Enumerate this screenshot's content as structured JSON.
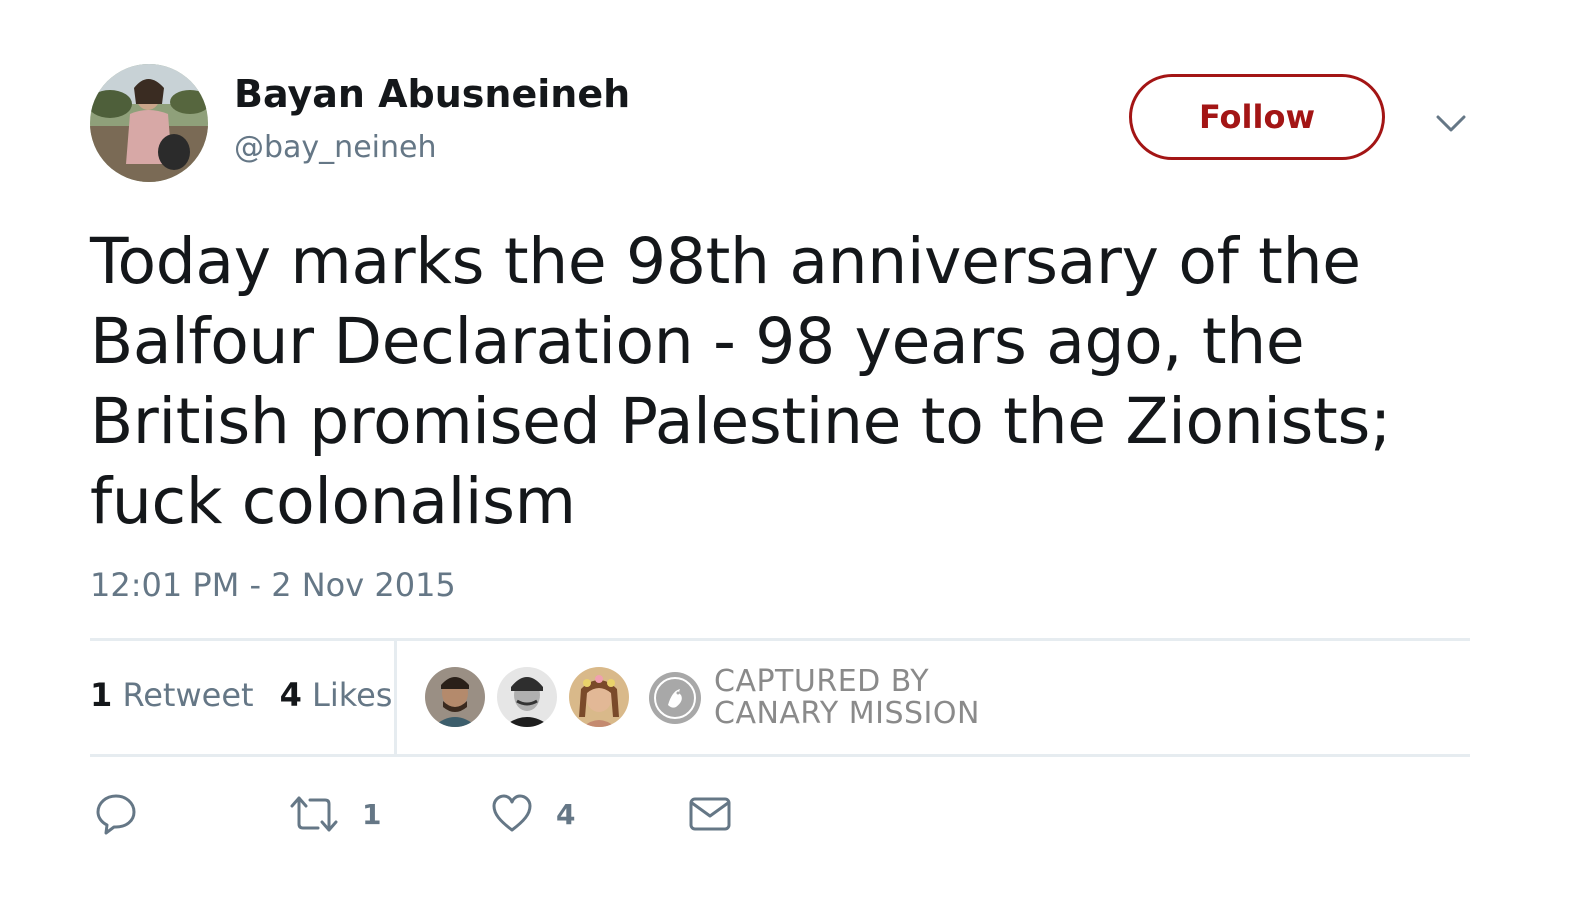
{
  "author": {
    "display_name": "Bayan Abusneineh",
    "handle": "@bay_neineh",
    "avatar_icon": "profile-photo"
  },
  "header": {
    "follow_label": "Follow",
    "caret_icon": "chevron-down-icon"
  },
  "tweet": {
    "text": "Today marks the 98th anniversary of the Balfour Declaration - 98 years ago, the British promised Palestine to the Zionists; fuck colonalism",
    "timestamp": "12:01 PM - 2 Nov 2015"
  },
  "stats": {
    "retweet_count": "1",
    "retweet_label": "Retweet",
    "like_count": "4",
    "like_label": "Likes"
  },
  "watermark": {
    "line1": "CAPTURED BY",
    "line2": "CANARY MISSION"
  },
  "actions": {
    "reply_icon": "reply-icon",
    "retweet_icon": "retweet-icon",
    "retweet_count": "1",
    "like_icon": "heart-icon",
    "like_count": "4",
    "dm_icon": "envelope-icon"
  },
  "colors": {
    "follow_accent": "#a31515",
    "secondary_text": "#657786",
    "primary_text": "#14171a",
    "divider": "#e6ecf0"
  }
}
